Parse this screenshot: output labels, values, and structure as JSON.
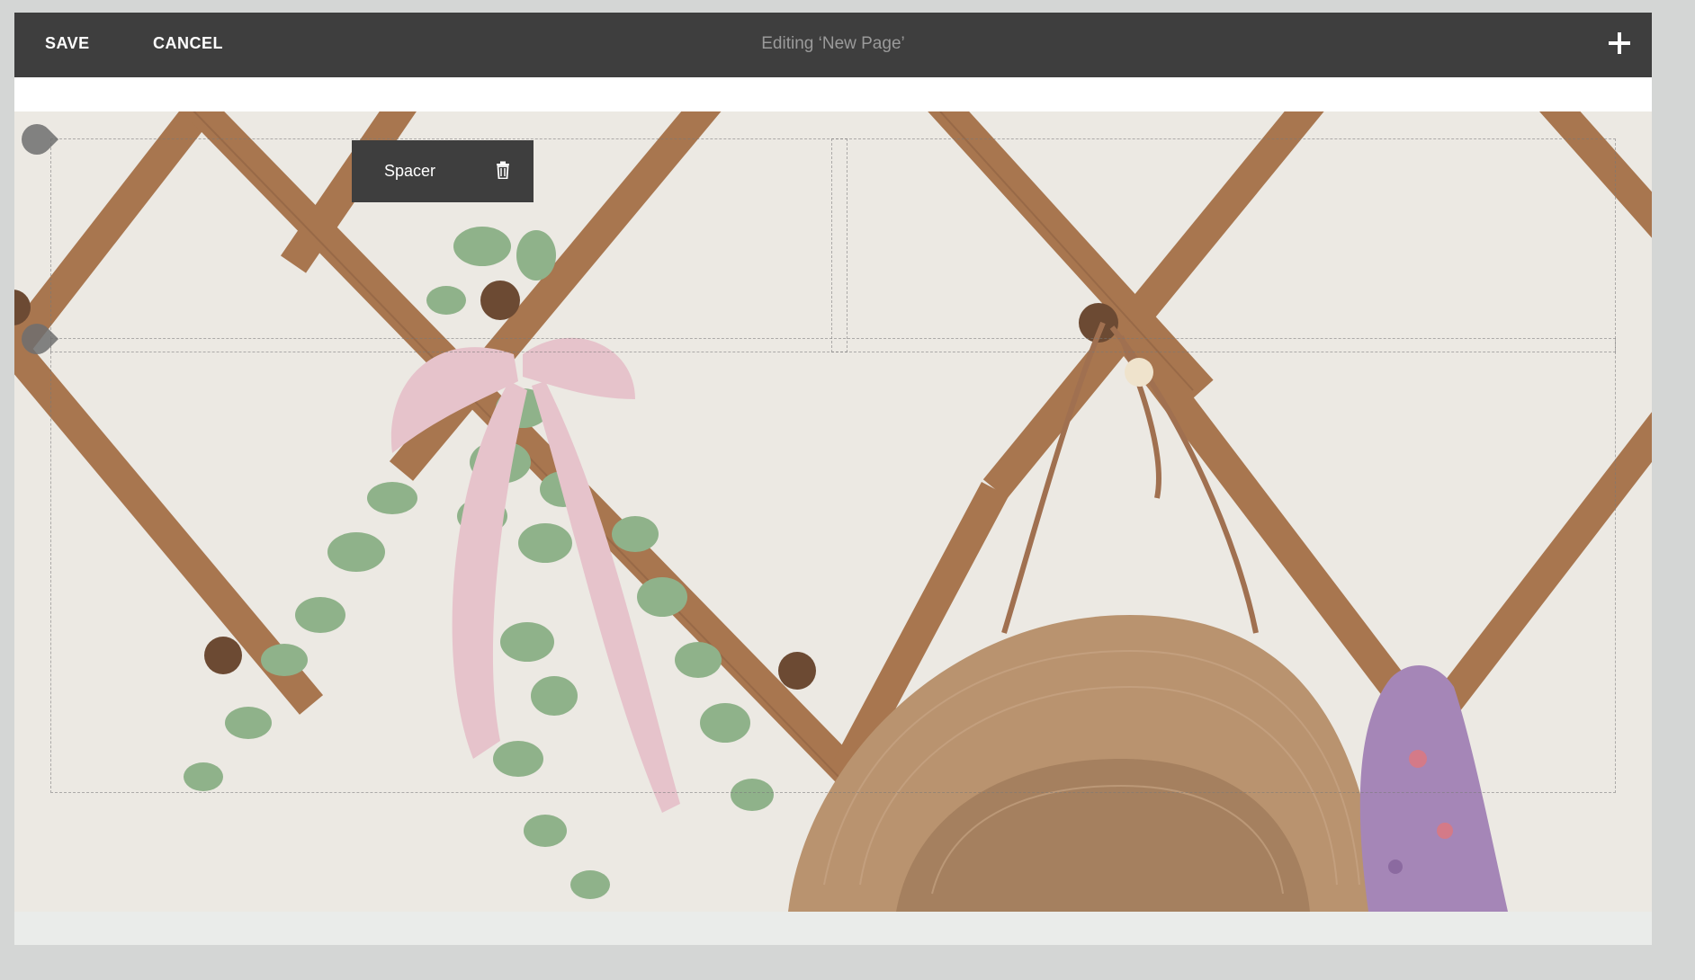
{
  "toolbar": {
    "save_label": "SAVE",
    "cancel_label": "CANCEL",
    "title": "Editing ‘New Page’",
    "add_icon": "plus-icon"
  },
  "block_toolbar": {
    "label": "Spacer",
    "delete_icon": "trash-icon"
  },
  "colors": {
    "toolbar_bg": "#3e3e3e",
    "toolbar_text": "#ffffff",
    "title_text": "#9a9a9a",
    "page_bg": "#d4d6d5",
    "wood": "#a87650",
    "ribbon": "#e8c4cc",
    "leaf": "#8fb28a",
    "hat": "#b99372",
    "scarf": "#a486b6"
  }
}
